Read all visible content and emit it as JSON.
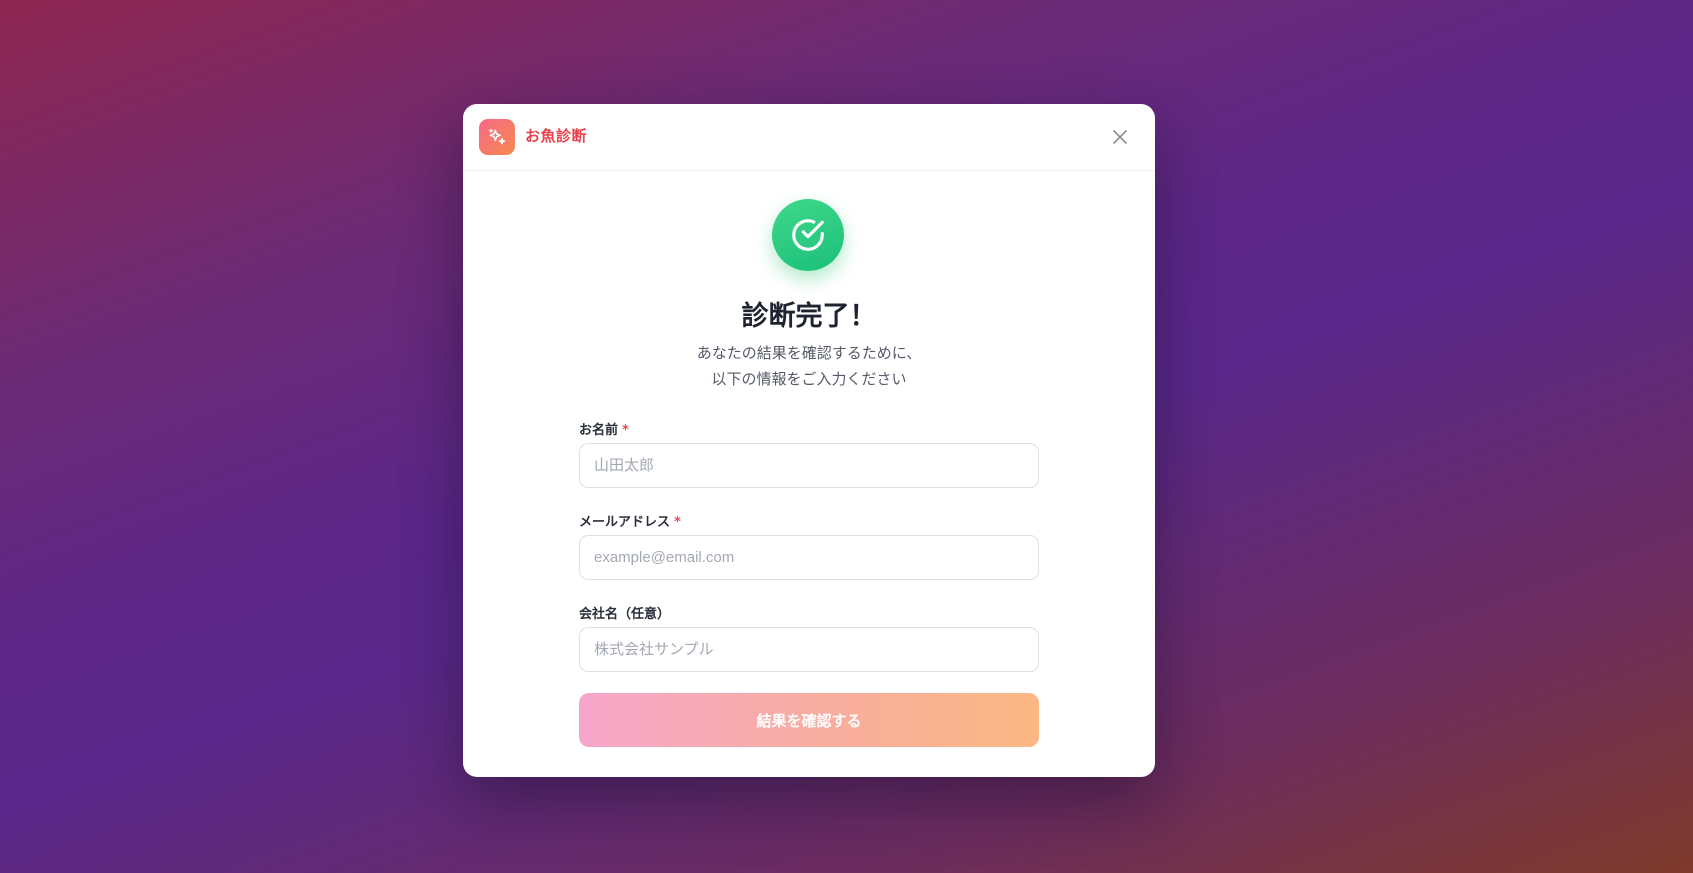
{
  "app": {
    "title": "お魚診断",
    "logo_icon": "sparkles-icon",
    "accent": "#e8434f"
  },
  "header": {
    "close_icon": "close-icon"
  },
  "status": {
    "icon": "check-circle-icon",
    "color": "#22c57a"
  },
  "heading": "診断完了！",
  "subtext": {
    "line1": "あなたの結果を確認するために、",
    "line2": "以下の情報をご入力ください"
  },
  "form": {
    "name": {
      "label": "お名前",
      "required_mark": "*",
      "placeholder": "山田太郎",
      "value": ""
    },
    "email": {
      "label": "メールアドレス",
      "required_mark": "*",
      "placeholder": "example@email.com",
      "value": ""
    },
    "company": {
      "label": "会社名（任意）",
      "placeholder": "株式会社サンプル",
      "value": ""
    },
    "submit_label": "結果を確認する"
  }
}
